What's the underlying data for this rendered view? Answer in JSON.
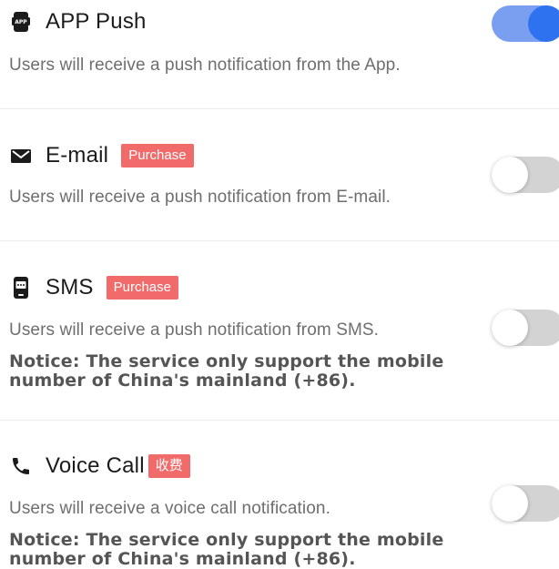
{
  "settings": [
    {
      "id": "app_push",
      "icon": "app-icon",
      "title": "APP Push",
      "badge": "",
      "description": "Users will receive a push notification from the App.",
      "notice": "",
      "enabled": true
    },
    {
      "id": "email",
      "icon": "mail-icon",
      "title": "E-mail",
      "badge": "Purchase",
      "description": "Users will receive a push notification from E-mail.",
      "notice": "",
      "enabled": false
    },
    {
      "id": "sms",
      "icon": "phone-message-icon",
      "title": "SMS",
      "badge": "Purchase",
      "description": "Users will receive a push notification from SMS.",
      "notice": "Notice: The service only support the mobile number of China's mainland (+86).",
      "enabled": false
    },
    {
      "id": "voice_call",
      "icon": "phone-handset-icon",
      "title": "Voice Call",
      "badge": "收费",
      "description": "Users will receive a voice call notification.",
      "notice": "Notice: The service only support the mobile number of China's mainland (+86).",
      "enabled": false
    }
  ],
  "colors": {
    "badge": "#f26b6b",
    "toggle_on_track": "#7a9ff0",
    "toggle_on_knob": "#2f72f0",
    "toggle_off_track": "#d3d3d3"
  }
}
